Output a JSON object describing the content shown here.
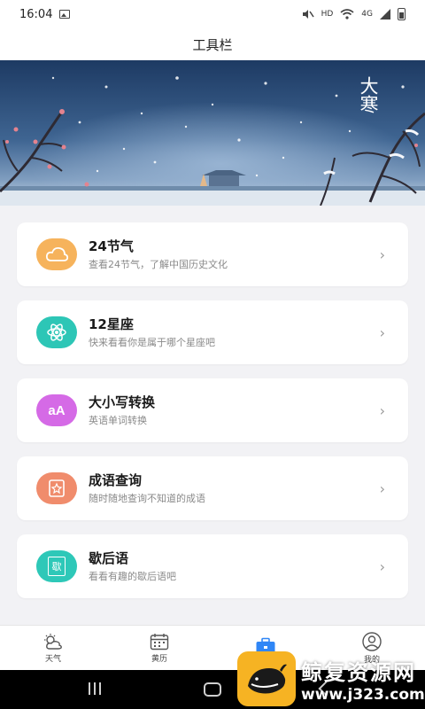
{
  "status_bar": {
    "time": "16:04",
    "hd_label": "HD",
    "network_label": "4G"
  },
  "header": {
    "title": "工具栏"
  },
  "banner": {
    "text": "大寒"
  },
  "tools": [
    {
      "title": "24节气",
      "subtitle": "查看24节气，了解中国历史文化",
      "icon": "cloud-icon",
      "color": "#f7b35e"
    },
    {
      "title": "12星座",
      "subtitle": "快来看看你是属于哪个星座吧",
      "icon": "atom-icon",
      "color": "#2ec7b8"
    },
    {
      "title": "大小写转换",
      "subtitle": "英语单词转换",
      "icon": "case-convert-icon",
      "color": "#d66be8",
      "icon_text": "aA"
    },
    {
      "title": "成语查询",
      "subtitle": "随时随地查询不知道的成语",
      "icon": "book-star-icon",
      "color": "#f28a6a"
    },
    {
      "title": "歇后语",
      "subtitle": "看看有趣的歇后语吧",
      "icon": "book-icon",
      "color": "#2fc9b9",
      "icon_text": "歇"
    }
  ],
  "tab_bar": {
    "tabs": [
      {
        "label": "天气",
        "icon": "weather-icon",
        "active": false
      },
      {
        "label": "黄历",
        "icon": "calendar-icon",
        "active": false
      },
      {
        "label": "",
        "icon": "toolbox-icon",
        "active": true
      },
      {
        "label": "我的",
        "icon": "profile-icon",
        "active": false
      }
    ]
  },
  "watermark": {
    "brand": "鲸复资源网",
    "url": "www.j323.com"
  },
  "colors": {
    "accent": "#2f86f6",
    "banner_dark": "#1f3c66"
  }
}
